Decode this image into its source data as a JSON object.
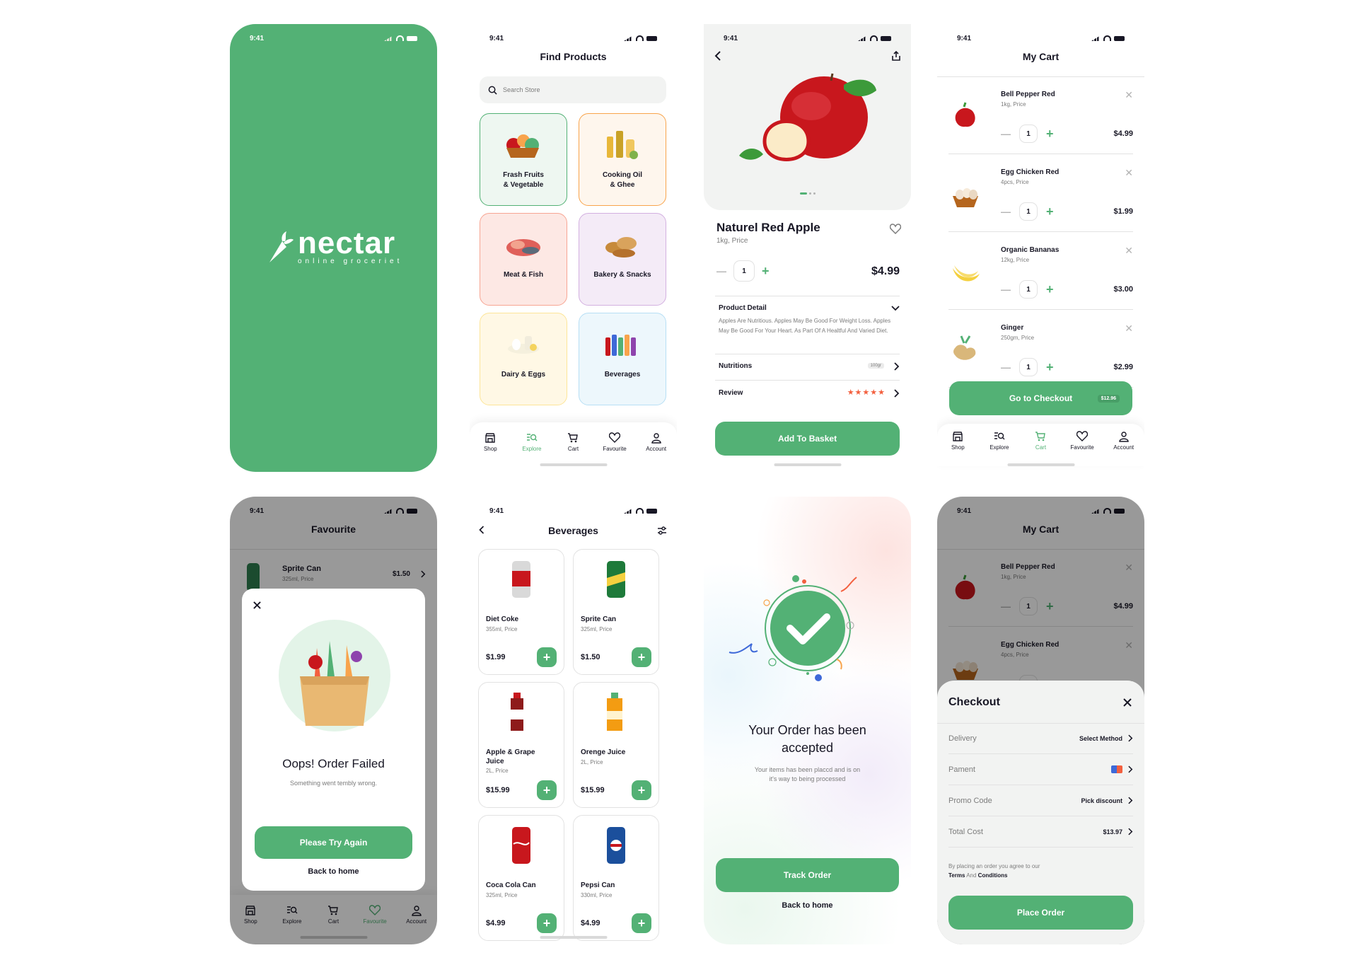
{
  "status_time": "9:41",
  "splash": {
    "brand": "nectar",
    "tagline": "online groceriet"
  },
  "explore": {
    "title": "Find Products",
    "search_placeholder": "Search Store",
    "categories": [
      {
        "line1": "Frash Fruits",
        "line2": "& Vegetable",
        "bg": "#EEF7F1",
        "border": "#53B175"
      },
      {
        "line1": "Cooking Oil",
        "line2": "& Ghee",
        "bg": "#FEF6ED",
        "border": "#F8A44C"
      },
      {
        "line1": "Meat & Fish",
        "line2": "",
        "bg": "#FDE8E4",
        "border": "#F7A593"
      },
      {
        "line1": "Bakery & Snacks",
        "line2": "",
        "bg": "#F4EBF7",
        "border": "#D3B0E0"
      },
      {
        "line1": "Dairy & Eggs",
        "line2": "",
        "bg": "#FFF8E5",
        "border": "#FDE598"
      },
      {
        "line1": "Beverages",
        "line2": "",
        "bg": "#EDF7FC",
        "border": "#B7DFF5"
      }
    ]
  },
  "tabs": [
    "Shop",
    "Explore",
    "Cart",
    "Favourite",
    "Account"
  ],
  "product": {
    "name": "Naturel Red Apple",
    "unit": "1kg, Price",
    "qty": "1",
    "price": "$4.99",
    "detail_title": "Product Detail",
    "detail_text": "Apples Are Nutritious. Apples May Be Good For Weight Loss. Apples May Be Good For Your Heart. As Part Of A Healtful And Varied Diet.",
    "nutritions": "Nutritions",
    "nutri_badge": "100gr",
    "review": "Review",
    "stars": "★★★★★",
    "add_btn": "Add To Basket"
  },
  "cart": {
    "title": "My Cart",
    "items": [
      {
        "name": "Bell Pepper Red",
        "unit": "1kg, Price",
        "qty": "1",
        "price": "$4.99"
      },
      {
        "name": "Egg Chicken Red",
        "unit": "4pcs, Price",
        "qty": "1",
        "price": "$1.99"
      },
      {
        "name": "Organic Bananas",
        "unit": "12kg, Price",
        "qty": "1",
        "price": "$3.00"
      },
      {
        "name": "Ginger",
        "unit": "250gm, Price",
        "qty": "1",
        "price": "$2.99"
      }
    ],
    "checkout_btn": "Go to Checkout",
    "checkout_total": "$12.96"
  },
  "fav": {
    "title": "Favourite",
    "item_name": "Sprite Can",
    "item_unit": "325ml, Price",
    "item_price": "$1.50",
    "fail_title": "Oops! Order Failed",
    "fail_sub": "Something went tembly wrong.",
    "retry": "Please Try Again",
    "back": "Back to home"
  },
  "beverages": {
    "title": "Beverages",
    "items": [
      {
        "name": "Diet Coke",
        "name2": "",
        "unit": "355ml, Price",
        "price": "$1.99"
      },
      {
        "name": "Sprite Can",
        "name2": "",
        "unit": "325ml, Price",
        "price": "$1.50"
      },
      {
        "name": "Apple & Grape",
        "name2": "Juice",
        "unit": "2L, Price",
        "price": "$15.99"
      },
      {
        "name": "Orenge Juice",
        "name2": "",
        "unit": "2L, Price",
        "price": "$15.99"
      },
      {
        "name": "Coca Cola Can",
        "name2": "",
        "unit": "325ml, Price",
        "price": "$4.99"
      },
      {
        "name": "Pepsi Can",
        "name2": "",
        "unit": "330ml, Price",
        "price": "$4.99"
      }
    ]
  },
  "accepted": {
    "title1": "Your Order has been",
    "title2": "accepted",
    "sub1": "Your items has been placcd and is on",
    "sub2": "it's way to being processed",
    "track": "Track Order",
    "back": "Back to home"
  },
  "checkout": {
    "title": "My Cart",
    "sheet_title": "Checkout",
    "delivery": "Delivery",
    "delivery_val": "Select Method",
    "payment": "Pament",
    "promo": "Promo Code",
    "promo_val": "Pick discount",
    "total": "Total Cost",
    "total_val": "$13.97",
    "terms1": "By placing an order you agree to our",
    "terms_a": "Terms",
    "terms_and": " And ",
    "terms_b": "Conditions",
    "place": "Place Order",
    "items": [
      {
        "name": "Bell Pepper Red",
        "unit": "1kg, Price",
        "qty": "1",
        "price": "$4.99"
      },
      {
        "name": "Egg Chicken Red",
        "unit": "4pcs, Price",
        "qty": "1",
        "price": "$1.99"
      }
    ]
  }
}
